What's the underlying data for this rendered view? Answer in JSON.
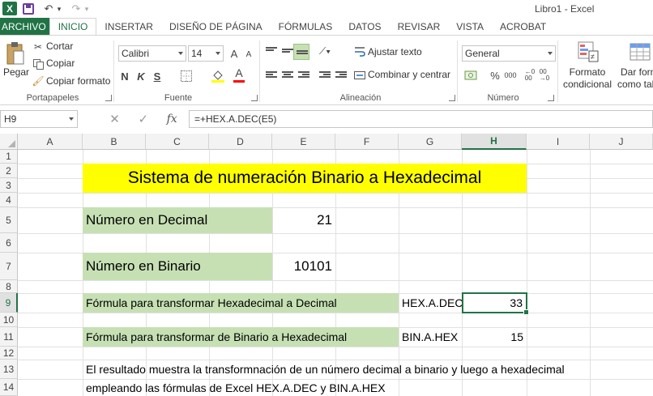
{
  "window": {
    "app_title": "Libro1 - Excel",
    "logo_letter": "X"
  },
  "quick_access": {
    "undo_glyph": "↶",
    "redo_glyph": "↷",
    "dropdown_glyph": "▾"
  },
  "tabs": [
    "ARCHIVO",
    "INICIO",
    "INSERTAR",
    "DISEÑO DE PÁGINA",
    "FÓRMULAS",
    "DATOS",
    "REVISAR",
    "VISTA",
    "ACROBAT"
  ],
  "active_tab": "INICIO",
  "ribbon": {
    "clipboard": {
      "paste": "Pegar",
      "cut": "Cortar",
      "copy": "Copiar",
      "format_painter": "Copiar formato",
      "label": "Portapapeles"
    },
    "font": {
      "name": "Calibri",
      "size": "14",
      "grow": "A",
      "shrink": "A",
      "bold": "N",
      "italic": "K",
      "underline": "S",
      "font_color_letter": "A",
      "label": "Fuente"
    },
    "alignment": {
      "wrap": "Ajustar texto",
      "merge": "Combinar y centrar",
      "label": "Alineación"
    },
    "number": {
      "format": "General",
      "percent": "%",
      "thousands": "000",
      "label": "Número"
    },
    "styles": {
      "conditional_1": "Formato",
      "conditional_2": "condicional",
      "table_1": "Dar form",
      "table_2": "como tab"
    }
  },
  "formula_bar": {
    "name_box": "H9",
    "cancel": "✕",
    "enter": "✓",
    "fx": "fx",
    "formula": "=+HEX.A.DEC(E5)"
  },
  "columns": [
    "A",
    "B",
    "C",
    "D",
    "E",
    "F",
    "G",
    "H",
    "I",
    "J"
  ],
  "selected_column": "H",
  "rows": [
    "1",
    "2",
    "3",
    "4",
    "5",
    "6",
    "7",
    "8",
    "9",
    "10",
    "11",
    "12",
    "13",
    "14"
  ],
  "selected_row": "9",
  "sheet": {
    "title": "Sistema de numeración Binario a Hexadecimal",
    "decimal_label": "Número en Decimal",
    "decimal_value": "21",
    "binary_label": "Número en Binario",
    "binary_value": "10101",
    "formula1_label": "Fórmula para transformar Hexadecimal a Decimal",
    "formula1_name": "HEX.A.DEC",
    "formula1_result": "33",
    "formula2_label": "Fórmula para transformar de Binario a Hexadecimal",
    "formula2_name": "BIN.A.HEX",
    "formula2_result": "15",
    "note_line1": "El resultado muestra la transformnación de un número decimal a binario y luego a hexadecimal",
    "note_line2": "empleando las fórmulas de Excel HEX.A.DEC y BIN.A.HEX"
  },
  "colors": {
    "accent": "#217346",
    "title_band": "#ffff00",
    "label_band": "#c6e0b4"
  }
}
